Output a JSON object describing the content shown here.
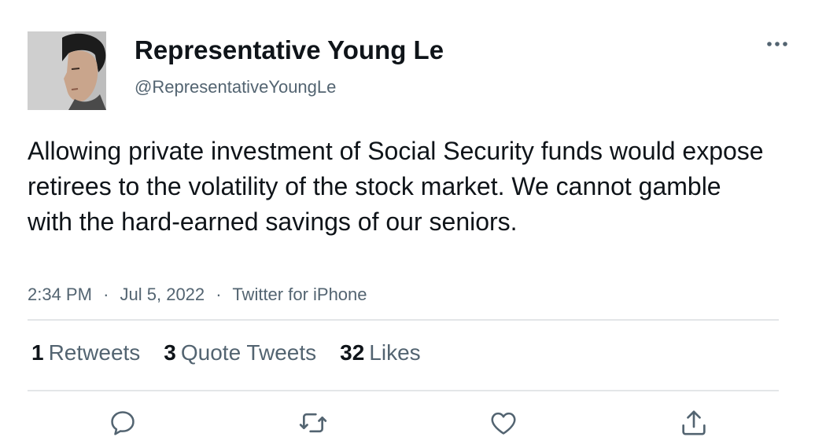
{
  "author": {
    "name": "Representative Young Le",
    "handle": "@RepresentativeYoungLe"
  },
  "tweet": {
    "text": "Allowing private investment of Social Security funds would expose retirees to the volatility of the stock market. We cannot gamble with the hard-earned savings of our seniors.",
    "time": "2:34 PM",
    "date": "Jul 5, 2022",
    "source": "Twitter for iPhone",
    "separator": "·"
  },
  "stats": {
    "retweets": {
      "count": "1",
      "label": "Retweets"
    },
    "quotes": {
      "count": "3",
      "label": "Quote Tweets"
    },
    "likes": {
      "count": "32",
      "label": "Likes"
    }
  },
  "icons": {
    "more": "more-icon",
    "reply": "reply-icon",
    "retweet": "retweet-icon",
    "like": "heart-icon",
    "share": "share-icon"
  },
  "colors": {
    "primary_text": "#0f1419",
    "secondary_text": "#536471",
    "icon": "#536471",
    "divider": "#e3e6e8"
  }
}
